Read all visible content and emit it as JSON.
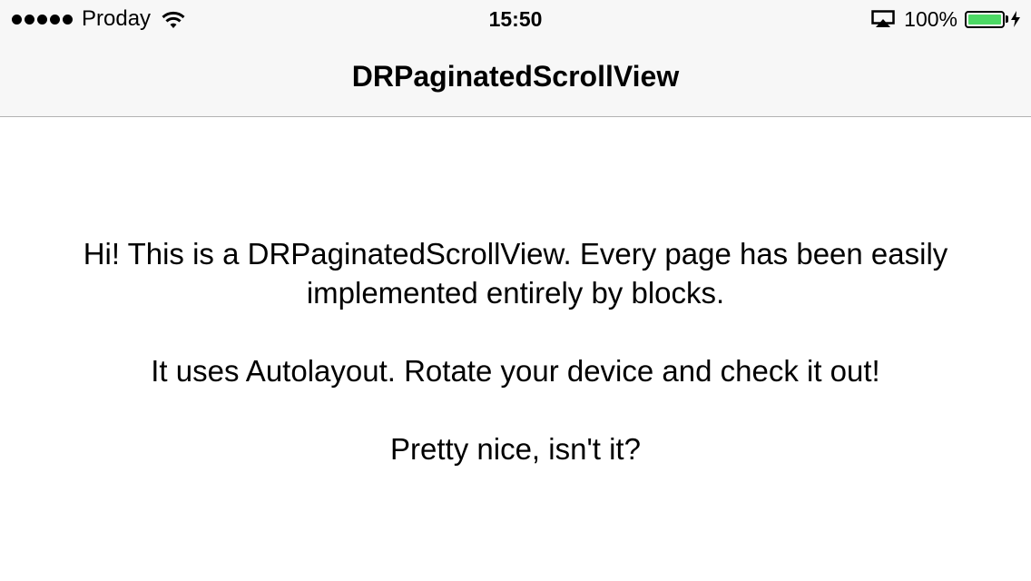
{
  "status_bar": {
    "signal_dots": 5,
    "carrier": "Proday",
    "time": "15:50",
    "battery_percent_label": "100%",
    "battery_level": 1.0,
    "battery_color": "#4cd964",
    "icons": [
      "signal-dots-icon",
      "wifi-icon",
      "airplay-icon",
      "battery-icon",
      "charging-bolt-icon"
    ]
  },
  "navbar": {
    "title": "DRPaginatedScrollView",
    "background": "#f7f7f7"
  },
  "page": {
    "paragraph_1": "Hi! This is a DRPaginatedScrollView. Every page has been easily implemented entirely by blocks.",
    "paragraph_2": "It uses Autolayout. Rotate your device and check it out!",
    "paragraph_3": "Pretty nice, isn't it?"
  }
}
